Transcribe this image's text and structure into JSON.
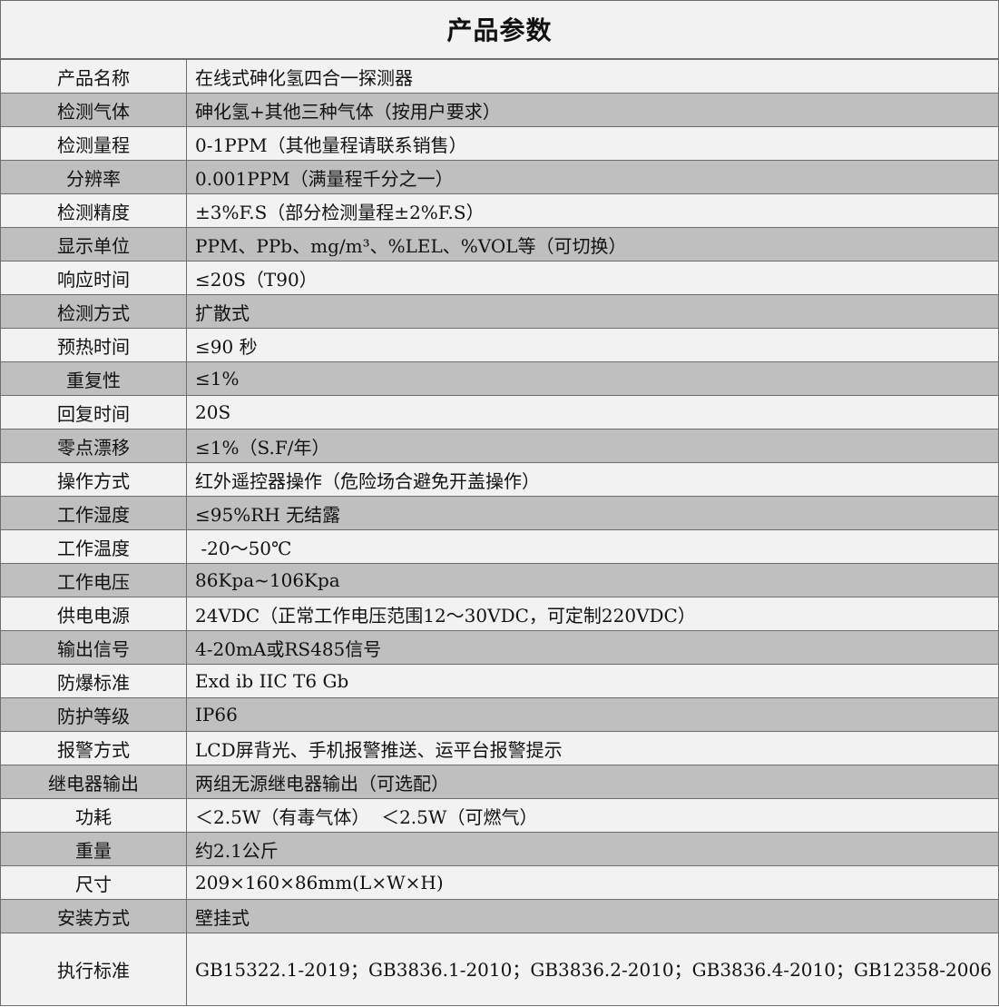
{
  "title": "产品参数",
  "rows": [
    {
      "label": "产品名称",
      "value": "在线式砷化氢四合一探测器"
    },
    {
      "label": "检测气体",
      "value": "砷化氢+其他三种气体（按用户要求）"
    },
    {
      "label": "检测量程",
      "value": "0-1PPM（其他量程请联系销售）"
    },
    {
      "label": "分辨率",
      "value": "0.001PPM（满量程千分之一）"
    },
    {
      "label": "检测精度",
      "value": "±3%F.S（部分检测量程±2%F.S）"
    },
    {
      "label": "显示单位",
      "value": "PPM、PPb、mg/m³、%LEL、%VOL等（可切换）"
    },
    {
      "label": "响应时间",
      "value": "≤20S（T90）"
    },
    {
      "label": "检测方式",
      "value": "扩散式"
    },
    {
      "label": "预热时间",
      "value": "≤90 秒"
    },
    {
      "label": "重复性",
      "value": "≤1%"
    },
    {
      "label": "回复时间",
      "value": "20S"
    },
    {
      "label": "零点漂移",
      "value": "≤1%（S.F/年）"
    },
    {
      "label": "操作方式",
      "value": "红外遥控器操作（危险场合避免开盖操作）"
    },
    {
      "label": "工作湿度",
      "value": "≤95%RH 无结露"
    },
    {
      "label": "工作温度",
      "value": " -20～50℃"
    },
    {
      "label": "工作电压",
      "value": "86Kpa~106Kpa"
    },
    {
      "label": "供电电源",
      "value": "24VDC（正常工作电压范围12～30VDC，可定制220VDC）"
    },
    {
      "label": "输出信号",
      "value": "4-20mA或RS485信号"
    },
    {
      "label": "防爆标准",
      "value": "Exd ib IIC T6 Gb"
    },
    {
      "label": "防护等级",
      "value": "IP66"
    },
    {
      "label": "报警方式",
      "value": "LCD屏背光、手机报警推送、运平台报警提示"
    },
    {
      "label": "继电器输出",
      "value": "两组无源继电器输出（可选配）"
    },
    {
      "label": "功耗",
      "value": "＜2.5W（有毒气体）  ＜2.5W（可燃气）"
    },
    {
      "label": "重量",
      "value": "约2.1公斤"
    },
    {
      "label": "尺寸",
      "value": "209×160×86mm(L×W×H)"
    },
    {
      "label": "安装方式",
      "value": "壁挂式"
    },
    {
      "label": "执行标准",
      "value": "GB15322.1-2019；GB3836.1-2010；GB3836.2-2010；GB3836.4-2010；GB12358-2006"
    }
  ]
}
